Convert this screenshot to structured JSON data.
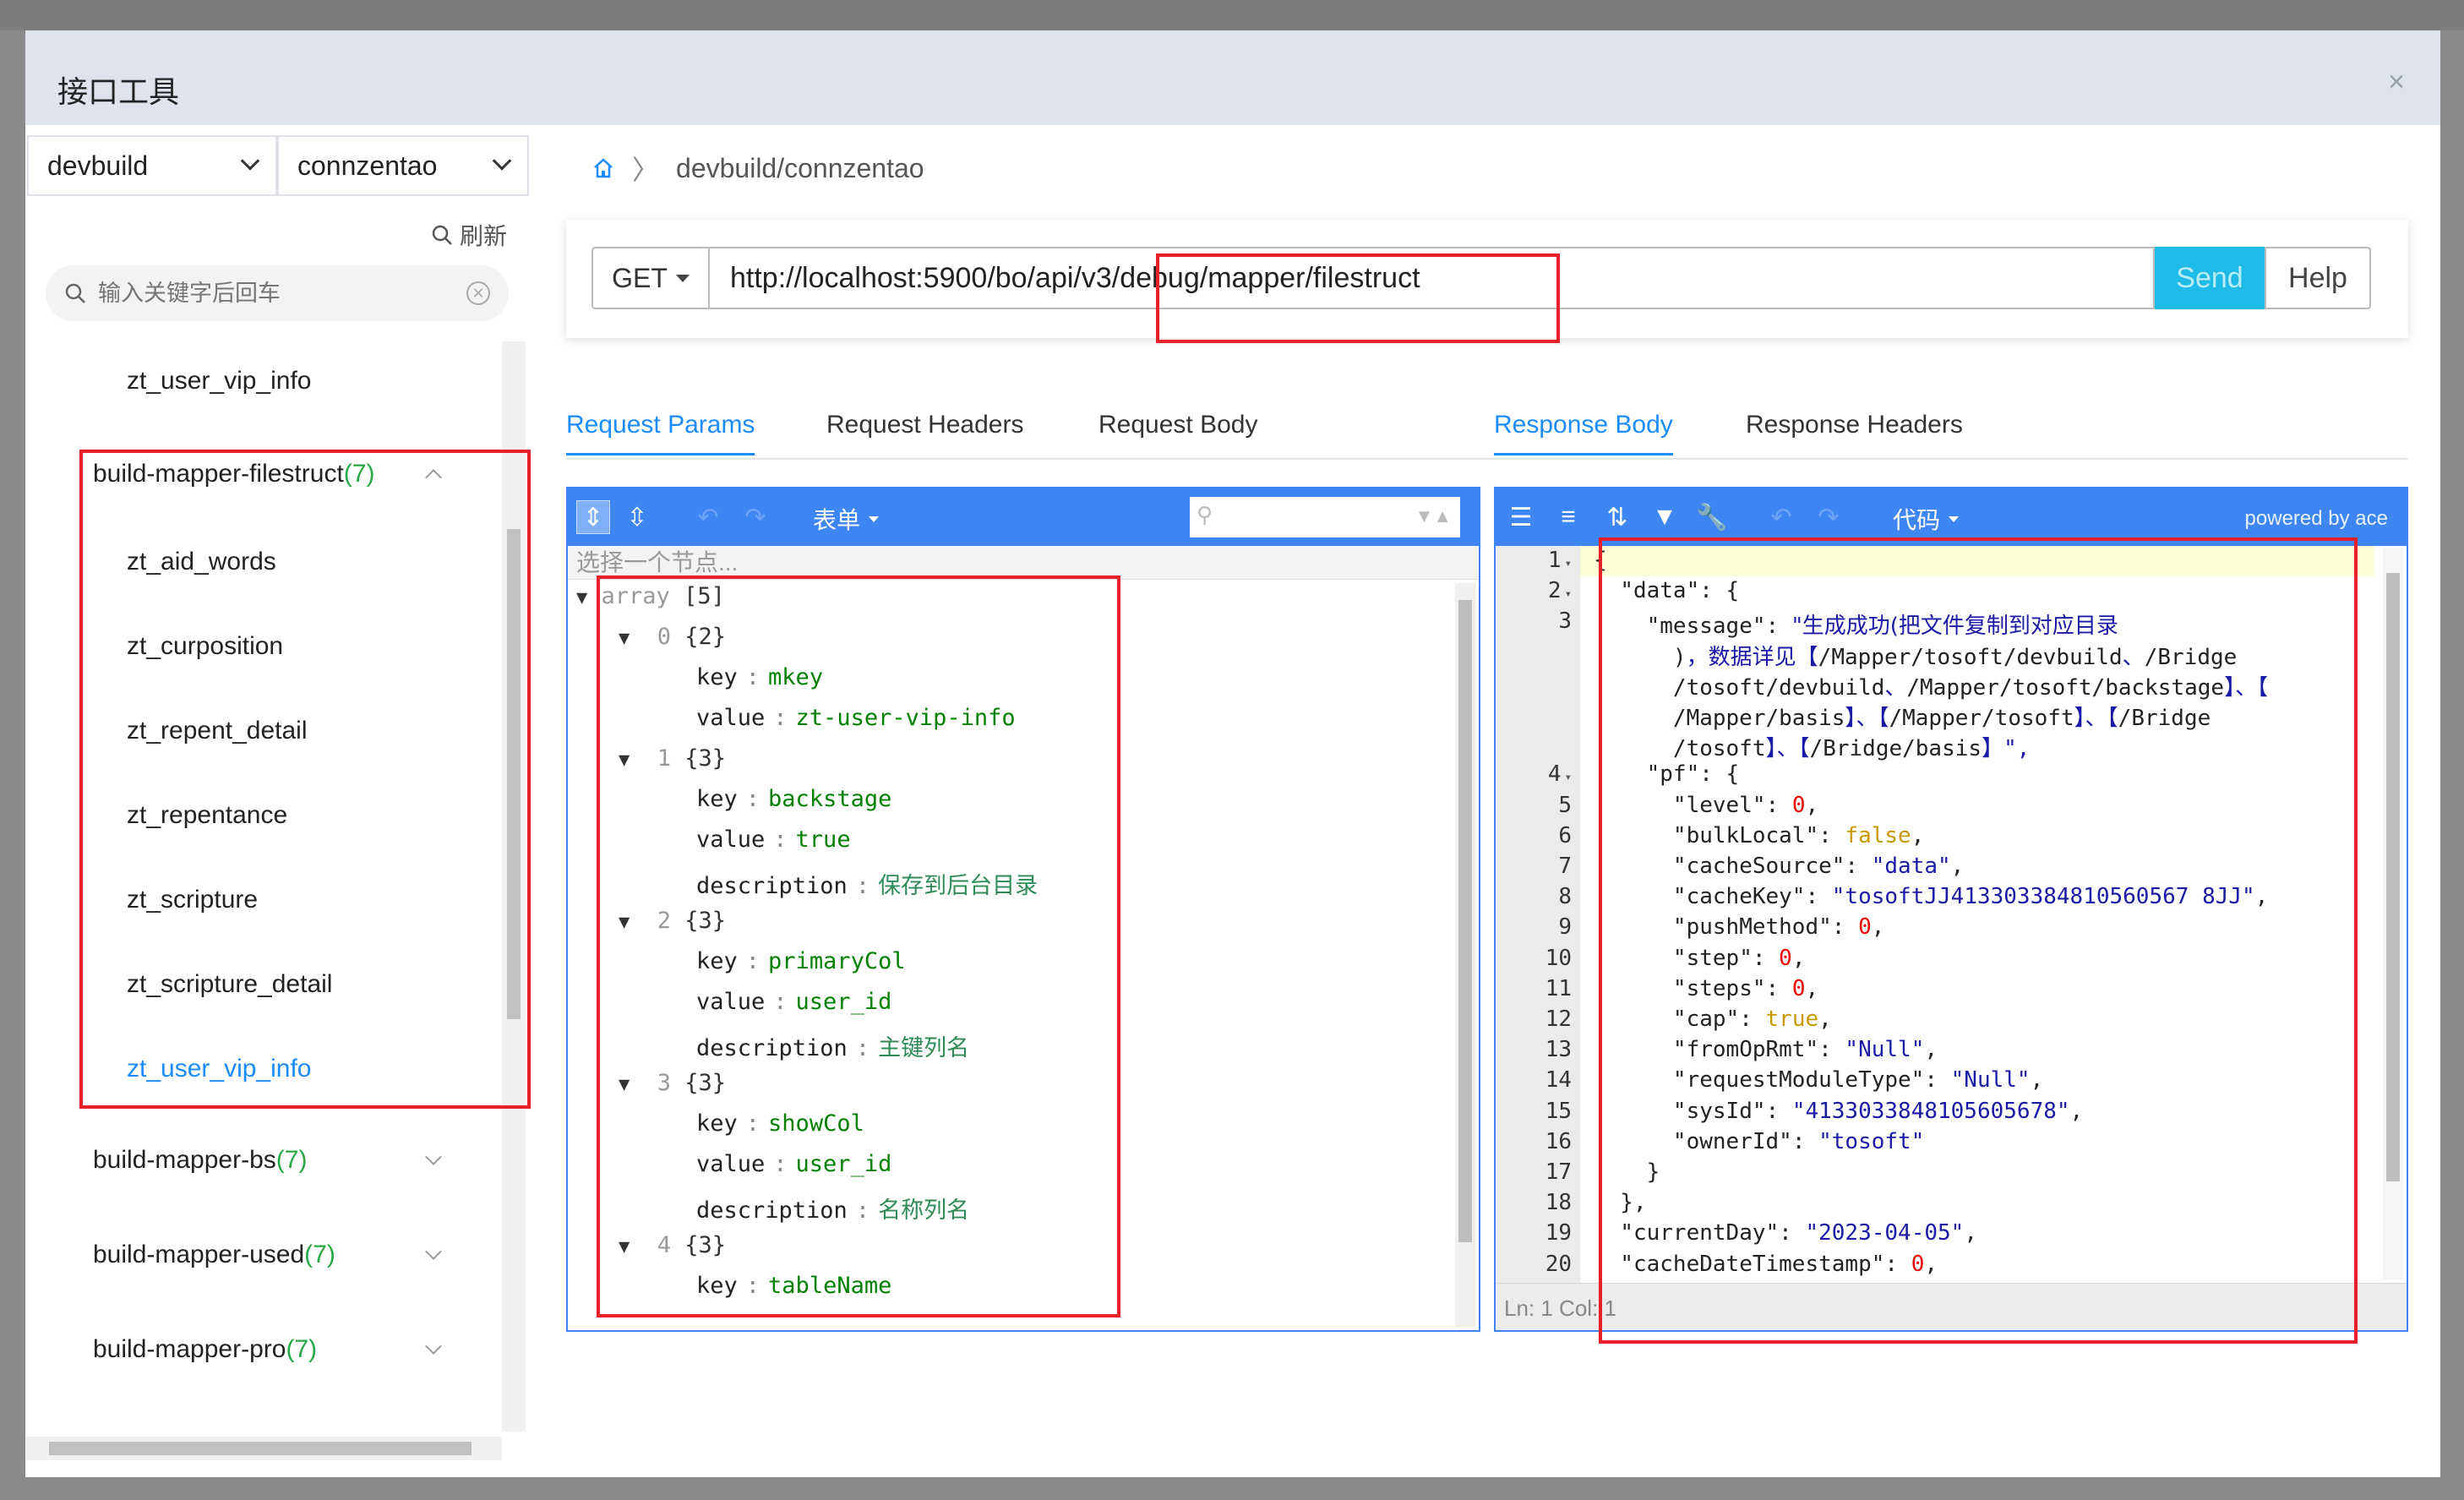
{
  "dialog": {
    "title": "接口工具",
    "close_symbol": "×"
  },
  "sidebar": {
    "project_select": "devbuild",
    "module_select": "connzentao",
    "refresh_label": "刷新",
    "search_placeholder": "输入关键字后回车",
    "top_item": "zt_user_vip_info",
    "expanded_group": {
      "label": "build-mapper-filestruct",
      "count": "(7)"
    },
    "children": [
      "zt_aid_words",
      "zt_curposition",
      "zt_repent_detail",
      "zt_repentance",
      "zt_scripture",
      "zt_scripture_detail",
      "zt_user_vip_info"
    ],
    "groups": [
      {
        "label": "build-mapper-bs",
        "count": "(7)"
      },
      {
        "label": "build-mapper-used",
        "count": "(7)"
      },
      {
        "label": "build-mapper-pro",
        "count": "(7)"
      }
    ]
  },
  "breadcrumb": {
    "path": "devbuild/connzentao"
  },
  "request": {
    "method": "GET",
    "url": "http://localhost:5900/bo/api/v3/debug/mapper/filestruct",
    "send_label": "Send",
    "help_label": "Help"
  },
  "tabs_left": [
    "Request Params",
    "Request Headers",
    "Request Body"
  ],
  "tabs_right": [
    "Response Body",
    "Response Headers"
  ],
  "params_editor": {
    "mode_label": "表单",
    "nav_hint": "选择一个节点...",
    "rows": [
      {
        "type": "node",
        "text": "array",
        "meta": "[5]"
      },
      {
        "type": "node",
        "idx": "0",
        "meta": "{2}"
      },
      {
        "type": "field",
        "key": "key",
        "value": "mkey"
      },
      {
        "type": "field",
        "key": "value",
        "value": "zt-user-vip-info"
      },
      {
        "type": "node",
        "idx": "1",
        "meta": "{3}"
      },
      {
        "type": "field",
        "key": "key",
        "value": "backstage"
      },
      {
        "type": "field",
        "key": "value",
        "value": "true"
      },
      {
        "type": "desc",
        "key": "description",
        "value": "保存到后台目录"
      },
      {
        "type": "node",
        "idx": "2",
        "meta": "{3}"
      },
      {
        "type": "field",
        "key": "key",
        "value": "primaryCol"
      },
      {
        "type": "field",
        "key": "value",
        "value": "user_id"
      },
      {
        "type": "desc",
        "key": "description",
        "value": "主键列名"
      },
      {
        "type": "node",
        "idx": "3",
        "meta": "{3}"
      },
      {
        "type": "field",
        "key": "key",
        "value": "showCol"
      },
      {
        "type": "field",
        "key": "value",
        "value": "user_id"
      },
      {
        "type": "desc",
        "key": "description",
        "value": "名称列名"
      },
      {
        "type": "node",
        "idx": "4",
        "meta": "{3}"
      },
      {
        "type": "field",
        "key": "key",
        "value": "tableName"
      }
    ]
  },
  "response_editor": {
    "mode_label": "代码",
    "powered_by": "powered by ace",
    "status": "Ln: 1    Col: 1",
    "gutter": [
      "1",
      "2",
      "3",
      "",
      "",
      "",
      "",
      "4",
      "5",
      "6",
      "7",
      "8",
      "9",
      "10",
      "11",
      "12",
      "13",
      "14",
      "15",
      "16",
      "17",
      "18",
      "19",
      "20"
    ],
    "lines": [
      "{",
      "  \"data\": {",
      "    \"message\": \"生成成功(把文件复制到对应目录",
      "      )，数据详见【/Mapper/tosoft/devbuild、/Bridge",
      "      /tosoft/devbuild、/Mapper/tosoft/backstage】、【",
      "      /Mapper/basis】、【/Mapper/tosoft】、【/Bridge",
      "      /tosoft】、【/Bridge/basis】\",",
      "    \"pf\": {",
      "      \"level\": 0,",
      "      \"bulkLocal\": false,",
      "      \"cacheSource\": \"data\",",
      "      \"cacheKey\": \"tosoftJJ413303384810560567 8JJ\",",
      "      \"pushMethod\": 0,",
      "      \"step\": 0,",
      "      \"steps\": 0,",
      "      \"cap\": true,",
      "      \"fromOpRmt\": \"Null\",",
      "      \"requestModuleType\": \"Null\",",
      "      \"sysId\": \"4133033848105605678\",",
      "      \"ownerId\": \"tosoft\"",
      "    }",
      "  },",
      "  \"currentDay\": \"2023-04-05\",",
      "  \"cacheDateTimestamp\": 0,"
    ]
  }
}
